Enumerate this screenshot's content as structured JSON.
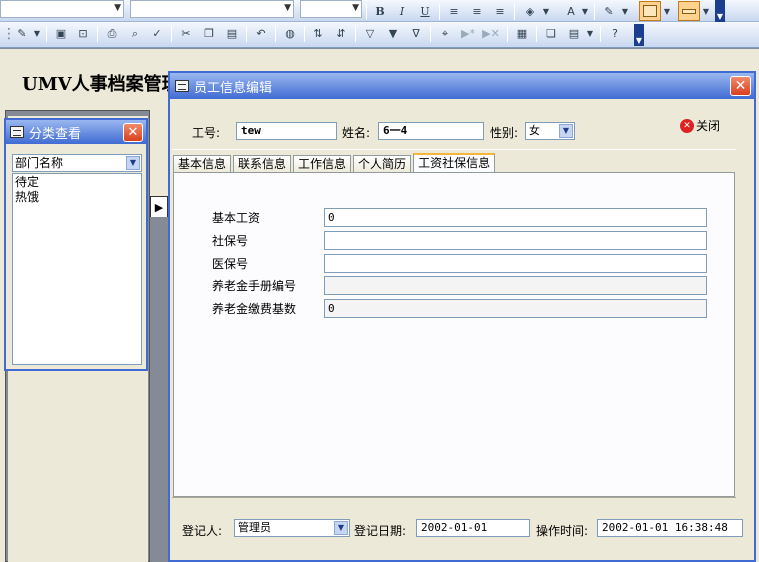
{
  "toolbar": {
    "format_buttons": {
      "bold": "B",
      "italic": "I",
      "underline": "U"
    },
    "font_color_glyph": "A"
  },
  "main_form": {
    "title": "UMV人事档案管理系",
    "row_selector_glyph": "▶"
  },
  "category_panel": {
    "title": "分类查看",
    "close_glyph": "✕",
    "filter_select": "部门名称",
    "items": [
      "待定",
      "热饿"
    ]
  },
  "employee_window": {
    "title": "员工信息编辑",
    "close_glyph": "✕",
    "id_label": "工号:",
    "id_value": "tew",
    "name_label": "姓名:",
    "name_value": "6一4",
    "gender_label": "性别:",
    "gender_value": "女",
    "close_button": "关闭",
    "tabs": [
      "基本信息",
      "联系信息",
      "工作信息",
      "个人简历",
      "工资社保信息"
    ],
    "active_tab": "工资社保信息",
    "salary_fields": [
      {
        "label": "基本工资",
        "value": "0"
      },
      {
        "label": "社保号",
        "value": ""
      },
      {
        "label": "医保号",
        "value": ""
      },
      {
        "label": "养老金手册编号",
        "value": ""
      },
      {
        "label": "养老金缴费基数",
        "value": "0"
      }
    ],
    "registrar_label": "登记人:",
    "registrar_value": "管理员",
    "reg_date_label": "登记日期:",
    "reg_date_value": "2002-01-01",
    "op_time_label": "操作时间:",
    "op_time_value": "2002-01-01 16:38:48"
  }
}
